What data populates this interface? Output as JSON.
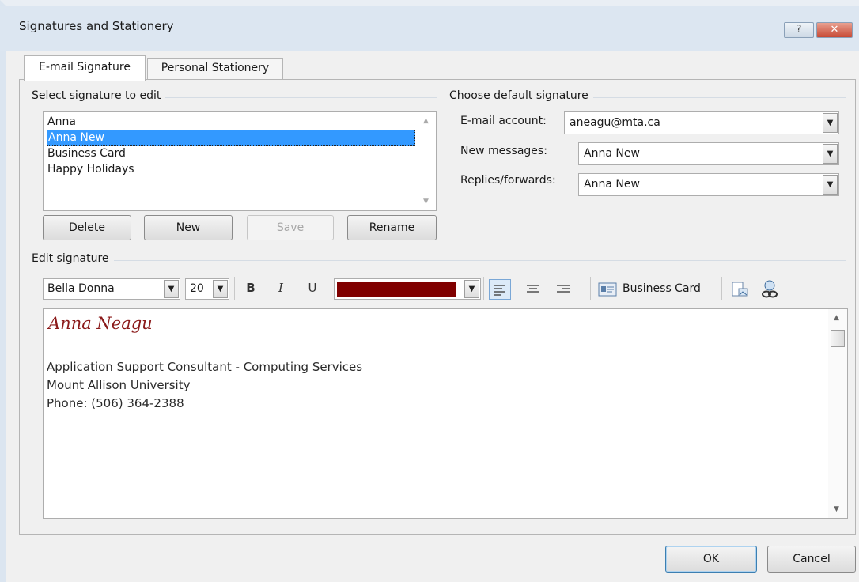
{
  "window": {
    "title": "Signatures and Stationery",
    "help_label": "?",
    "close_label": "✕"
  },
  "tabs": [
    {
      "label": "E-mail Signature",
      "active": true
    },
    {
      "label": "Personal Stationery",
      "active": false
    }
  ],
  "select_section": {
    "title": "Select signature to edit",
    "items": [
      "Anna",
      "Anna New",
      "Business Card",
      "Happy Holidays"
    ],
    "selected": "Anna New",
    "buttons": {
      "delete": "Delete",
      "new": "New",
      "save": "Save",
      "rename": "Rename"
    }
  },
  "default_section": {
    "title": "Choose default signature",
    "email_account_label": "E-mail account:",
    "email_account_value": "aneagu@mta.ca",
    "new_messages_label": "New messages:",
    "new_messages_value": "Anna New",
    "replies_label": "Replies/forwards:",
    "replies_value": "Anna New"
  },
  "edit_section": {
    "title": "Edit signature",
    "font_name": "Bella Donna",
    "font_size": "20",
    "bold_label": "B",
    "italic_label": "I",
    "underline_label": "U",
    "font_color": "#800000",
    "business_card_label": "Business Card",
    "signature": {
      "name": "Anna Neagu",
      "lines": [
        "Application Support Consultant - Computing Services",
        "Mount Allison University",
        "Phone: (506) 364-2388"
      ],
      "name_color": "#8b1a1a"
    }
  },
  "footer": {
    "ok": "OK",
    "cancel": "Cancel"
  },
  "colors": {
    "selection": "#3399ff",
    "title_bar": "#dce6f1",
    "dialog_bg": "#f0f0f0"
  }
}
